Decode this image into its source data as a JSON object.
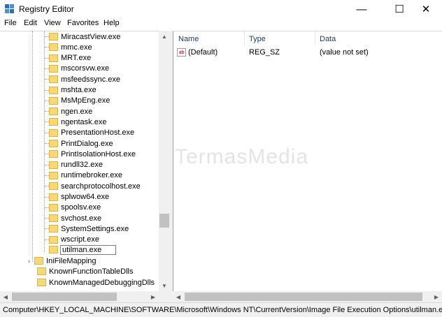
{
  "window": {
    "title": "Registry Editor",
    "minimize_glyph": "—",
    "maximize_glyph": "☐",
    "close_glyph": "✕"
  },
  "menu": [
    "File",
    "Edit",
    "View",
    "Favorites",
    "Help"
  ],
  "tree": {
    "children": [
      "MiracastView.exe",
      "mmc.exe",
      "MRT.exe",
      "mscorsvw.exe",
      "msfeedssync.exe",
      "mshta.exe",
      "MsMpEng.exe",
      "ngen.exe",
      "ngentask.exe",
      "PresentationHost.exe",
      "PrintDialog.exe",
      "PrintIsolationHost.exe",
      "rundll32.exe",
      "runtimebroker.exe",
      "searchprotocolhost.exe",
      "splwow64.exe",
      "spoolsv.exe",
      "svchost.exe",
      "SystemSettings.exe",
      "wscript.exe"
    ],
    "editing_item": "utilman.exe",
    "parents": [
      "IniFileMapping",
      "KnownFunctionTableDlls",
      "KnownManagedDebuggingDlls"
    ]
  },
  "list": {
    "columns": {
      "name": "Name",
      "type": "Type",
      "data": "Data"
    },
    "rows": [
      {
        "name": "(Default)",
        "type": "REG_SZ",
        "data": "(value not set)",
        "icon": "ab"
      }
    ]
  },
  "watermark": "TermasMedia",
  "status": "Computer\\HKEY_LOCAL_MACHINE\\SOFTWARE\\Microsoft\\Windows NT\\CurrentVersion\\Image File Execution Options\\utilman.exe",
  "colors": {
    "folder": "#f8d775",
    "header_text": "#1e395b"
  }
}
